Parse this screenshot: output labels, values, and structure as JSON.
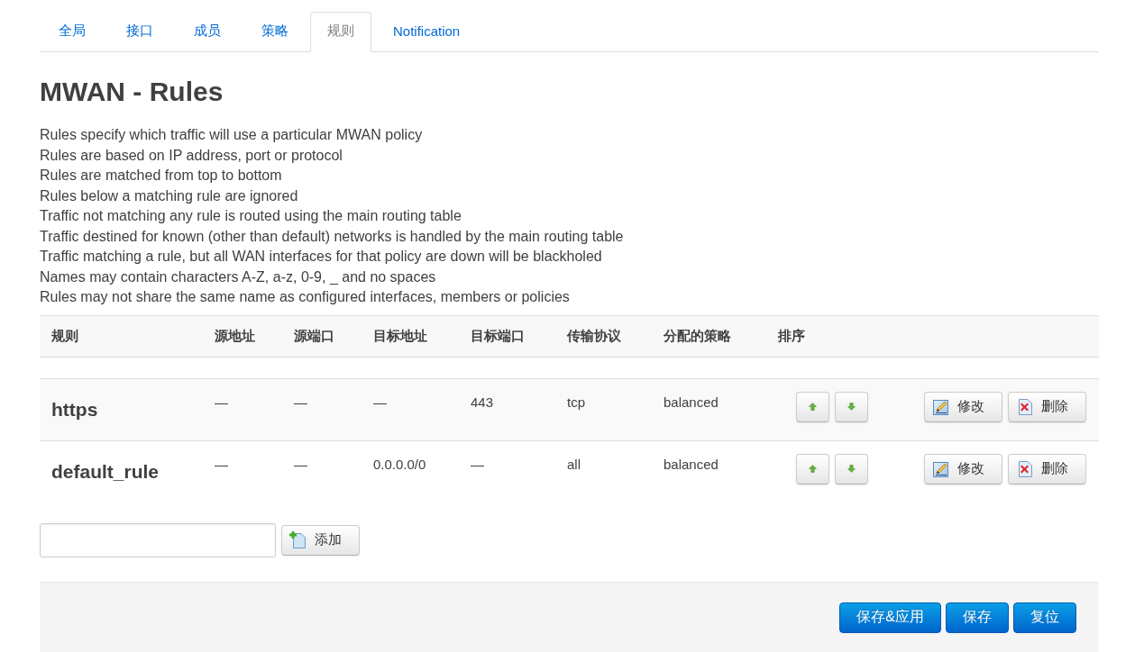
{
  "tabs": [
    {
      "label": "全局",
      "selected": false
    },
    {
      "label": "接口",
      "selected": false
    },
    {
      "label": "成员",
      "selected": false
    },
    {
      "label": "策略",
      "selected": false
    },
    {
      "label": "规则",
      "selected": true
    },
    {
      "label": "Notification",
      "selected": false
    }
  ],
  "page_title": "MWAN - Rules",
  "description": [
    "Rules specify which traffic will use a particular MWAN policy",
    "Rules are based on IP address, port or protocol",
    "Rules are matched from top to bottom",
    "Rules below a matching rule are ignored",
    "Traffic not matching any rule is routed using the main routing table",
    "Traffic destined for known (other than default) networks is handled by the main routing table",
    "Traffic matching a rule, but all WAN interfaces for that policy are down will be blackholed",
    "Names may contain characters A-Z, a-z, 0-9, _ and no spaces",
    "Rules may not share the same name as configured interfaces, members or policies"
  ],
  "table": {
    "columns": [
      "规则",
      "源地址",
      "源端口",
      "目标地址",
      "目标端口",
      "传输协议",
      "分配的策略",
      "排序"
    ],
    "rows": [
      {
        "cells": [
          "https",
          "—",
          "—",
          "—",
          "443",
          "tcp",
          "balanced"
        ],
        "edit_label": "修改",
        "delete_label": "删除"
      },
      {
        "cells": [
          "default_rule",
          "—",
          "—",
          "0.0.0.0/0",
          "—",
          "all",
          "balanced"
        ],
        "edit_label": "修改",
        "delete_label": "删除"
      }
    ]
  },
  "add_form": {
    "button": "添加"
  },
  "footer_buttons": [
    {
      "label": "保存&应用"
    },
    {
      "label": "保存"
    },
    {
      "label": "复位"
    }
  ]
}
